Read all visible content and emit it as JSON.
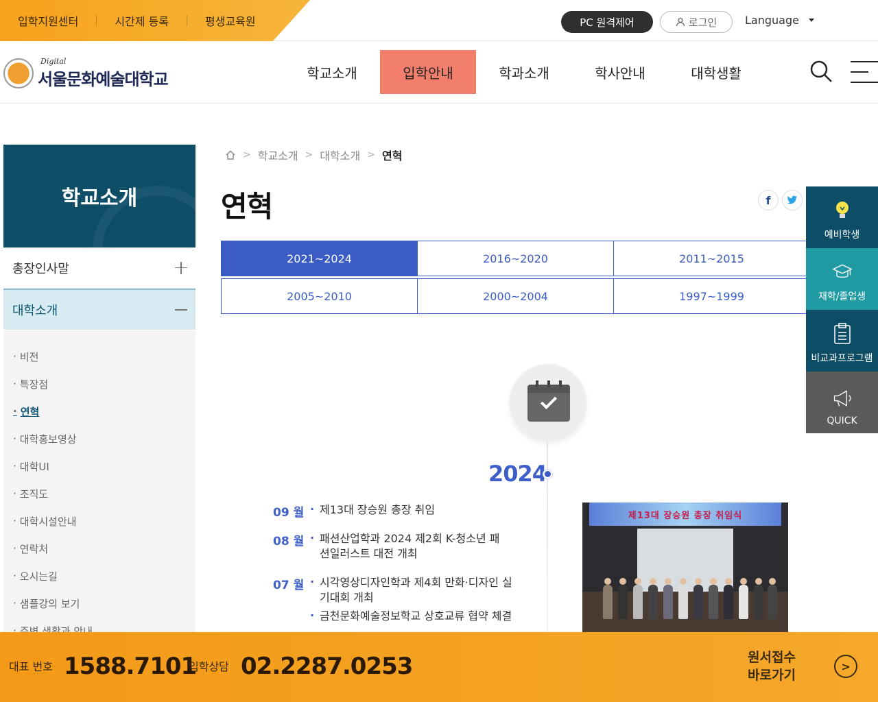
{
  "topbar": {
    "links": [
      "입학지원센터",
      "시간제 등록",
      "평생교육원"
    ],
    "remote_label": "PC 원격제어",
    "login_label": "로그인",
    "language_label": "Language"
  },
  "header": {
    "logo_digital": "Digital",
    "logo_name": "서울문화예술대학교",
    "nav": [
      "학교소개",
      "입학안내",
      "학과소개",
      "학사안내",
      "대학생활"
    ],
    "active_nav": "입학안내"
  },
  "sidebar": {
    "banner_title": "학교소개",
    "groups": [
      "총장인사말",
      "대학소개"
    ],
    "sub_items": [
      "비전",
      "특장점",
      "연혁",
      "대학홍보영상",
      "대학UI",
      "조직도",
      "대학시설안내",
      "연락처",
      "오시는길",
      "샘플강의 보기",
      "주변 생활과 안내"
    ],
    "current_sub": "연혁"
  },
  "breadcrumb": {
    "items": [
      "학교소개",
      "대학소개",
      "연혁"
    ]
  },
  "page": {
    "title": "연혁",
    "share_facebook": "f",
    "share_twitter": "t"
  },
  "tabs": {
    "row1": [
      "2021~2024",
      "2016~2020",
      "2011~2015"
    ],
    "row2": [
      "2005~2010",
      "2000~2004",
      "1997~1999"
    ],
    "active": "2021~2024"
  },
  "timeline": {
    "year": "2024",
    "events": [
      {
        "month": "09 월",
        "items": [
          "제13대 장승원 총장 취임"
        ]
      },
      {
        "month": "08 월",
        "items": [
          "패션산업학과 2024 제2회 K-청소년 패션일러스트 대전 개최"
        ]
      },
      {
        "month": "07 월",
        "items": [
          "시각영상디자인학과 제4회 만화·디자인 실기대회 개최",
          "금천문화예술정보학교 상호교류 협약 체결"
        ]
      }
    ],
    "photo_banner": "제13대 장승원 총장 취임식"
  },
  "quick": {
    "items": [
      "예비학생",
      "재학/졸업생",
      "비교과프로그램",
      "QUICK"
    ]
  },
  "footer": {
    "rep_label": "대표 번호",
    "rep_number": "1588.7101",
    "consult_label": "입학상담",
    "consult_number": "02.2287.0253",
    "apply_line1": "원서접수",
    "apply_line2": "바로가기"
  },
  "colors": {
    "accent_orange": "#f7a21b",
    "active_nav_bg": "#f27f6c",
    "sidebar_banner": "#0d4e66",
    "tab_blue": "#3b5cc4"
  }
}
